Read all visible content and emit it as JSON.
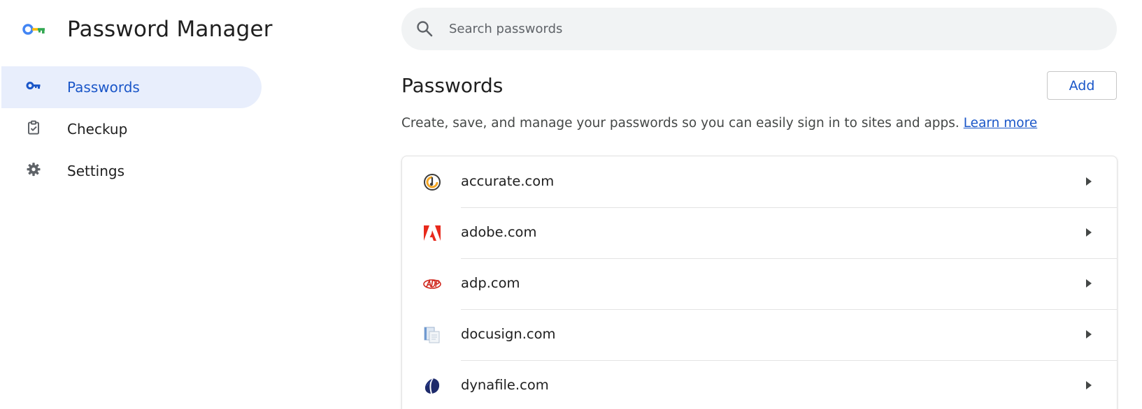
{
  "app": {
    "title": "Password Manager",
    "logo_icon": "password-manager-key-logo"
  },
  "sidebar": {
    "items": [
      {
        "label": "Passwords",
        "icon": "key-icon",
        "active": true
      },
      {
        "label": "Checkup",
        "icon": "clipboard-check-icon",
        "active": false
      },
      {
        "label": "Settings",
        "icon": "gear-icon",
        "active": false
      }
    ]
  },
  "search": {
    "placeholder": "Search passwords",
    "value": "",
    "icon": "search-icon"
  },
  "main": {
    "section_title": "Passwords",
    "add_label": "Add",
    "description": "Create, save, and manage your passwords so you can easily sign in to sites and apps.",
    "learn_more": "Learn more",
    "passwords": [
      {
        "site": "accurate.com",
        "icon": "accurate-favicon"
      },
      {
        "site": "adobe.com",
        "icon": "adobe-favicon"
      },
      {
        "site": "adp.com",
        "icon": "adp-favicon"
      },
      {
        "site": "docusign.com",
        "icon": "docusign-favicon"
      },
      {
        "site": "dynafile.com",
        "icon": "dynafile-favicon"
      }
    ]
  },
  "colors": {
    "accent": "#1a56c8",
    "active_nav_bg": "#e8eefc",
    "search_bg": "#f1f3f4",
    "divider": "#e3e3e3"
  }
}
